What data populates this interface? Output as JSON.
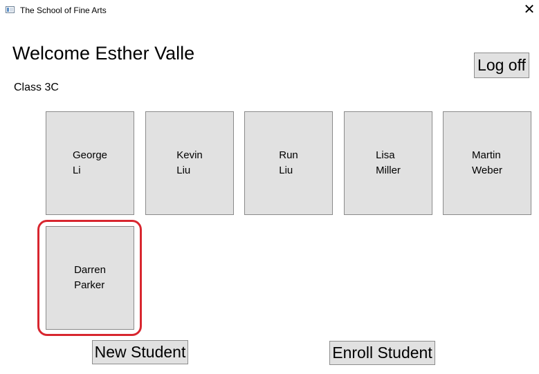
{
  "window": {
    "title": "The School of Fine Arts",
    "close_glyph": "✕",
    "icon": "app-window-icon"
  },
  "header": {
    "welcome": "Welcome Esther Valle",
    "class_label": "Class 3C",
    "logoff_label": "Log off"
  },
  "students": [
    {
      "first": "George",
      "last": "Li"
    },
    {
      "first": "Kevin",
      "last": "Liu"
    },
    {
      "first": "Run",
      "last": "Liu"
    },
    {
      "first": "Lisa",
      "last": "Miller"
    },
    {
      "first": "Martin",
      "last": "Weber"
    },
    {
      "first": "Darren",
      "last": "Parker",
      "highlighted": true
    }
  ],
  "footer": {
    "new_student_label": "New Student",
    "enroll_student_label": "Enroll Student"
  },
  "colors": {
    "highlight": "#d8262f",
    "button_face": "#e1e1e1"
  }
}
